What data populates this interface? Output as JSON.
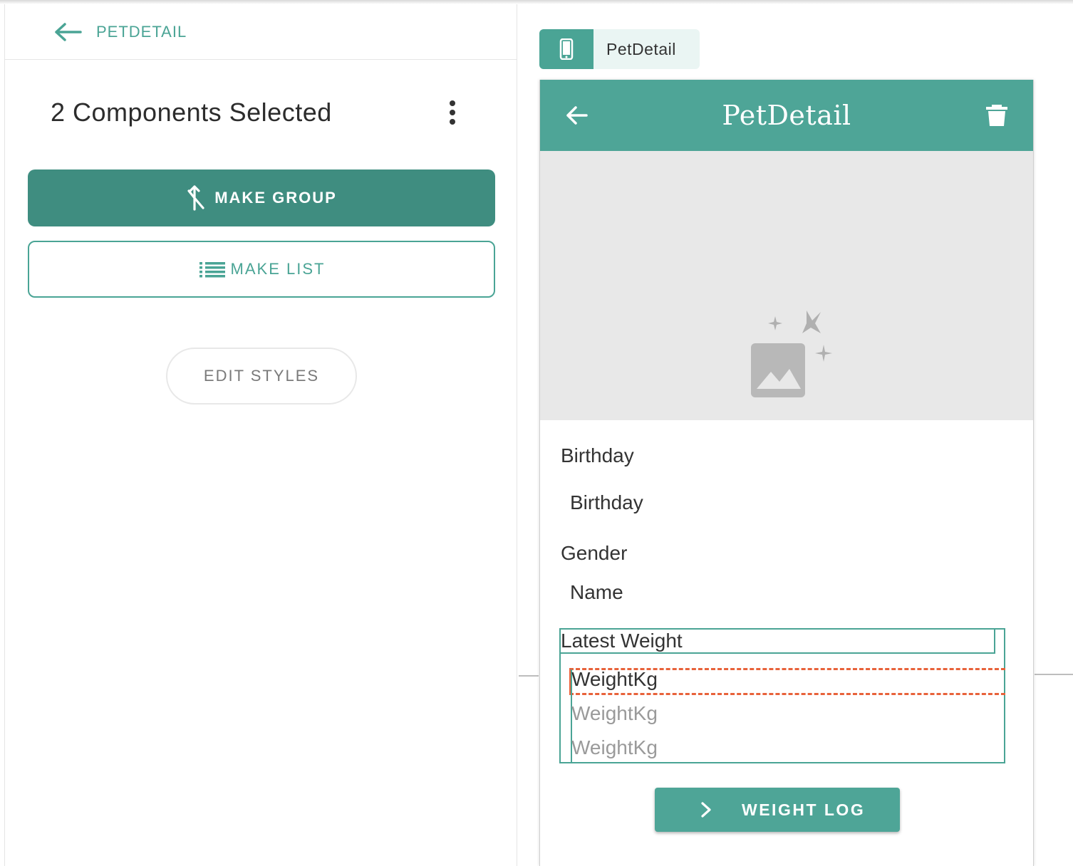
{
  "left": {
    "back_label": "PETDETAIL",
    "selected_title": "2 Components Selected",
    "make_group_label": "MAKE GROUP",
    "make_list_label": "MAKE LIST",
    "edit_styles_label": "EDIT STYLES"
  },
  "screen_tab": {
    "label": "PetDetail"
  },
  "phone": {
    "appbar_title": "PetDetail",
    "birthday_label": "Birthday",
    "birthday_value": "Birthday",
    "gender_label": "Gender",
    "gender_value": "Name",
    "weight_label": "Latest Weight",
    "weight_items": [
      "WeightKg",
      "WeightKg",
      "WeightKg"
    ],
    "weight_log_label": "WEIGHT LOG"
  },
  "colors": {
    "accent": "#4aa495",
    "accent_dark": "#3f8d80",
    "selection_dash": "#e8623a"
  }
}
